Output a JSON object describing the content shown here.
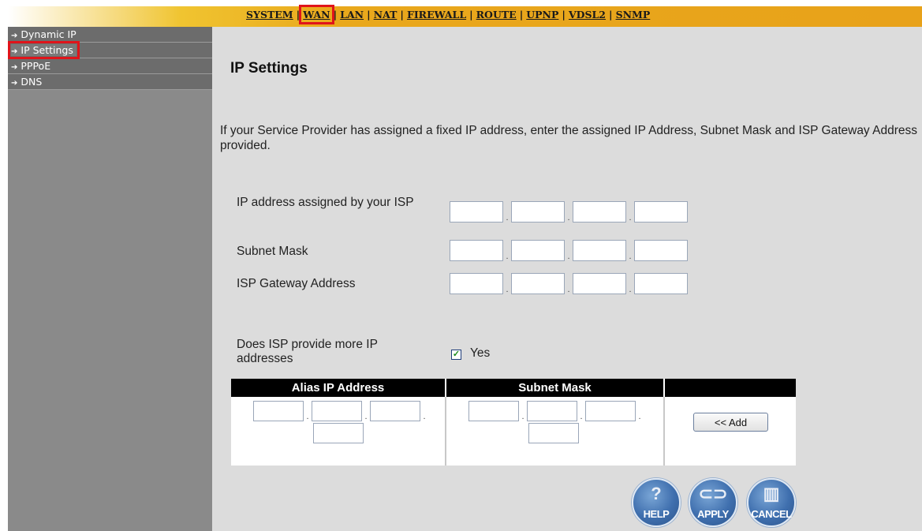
{
  "top_nav": {
    "tabs": [
      {
        "label": "SYSTEM",
        "active": false
      },
      {
        "label": "WAN",
        "active": true
      },
      {
        "label": "LAN",
        "active": false
      },
      {
        "label": "NAT",
        "active": false
      },
      {
        "label": "FIREWALL",
        "active": false
      },
      {
        "label": "ROUTE",
        "active": false
      },
      {
        "label": "UPNP",
        "active": false
      },
      {
        "label": "VDSL2",
        "active": false
      },
      {
        "label": "SNMP",
        "active": false
      }
    ],
    "separator": "|"
  },
  "sidebar": {
    "items": [
      {
        "label": "Dynamic IP",
        "active": false
      },
      {
        "label": "IP Settings",
        "active": true
      },
      {
        "label": "PPPoE",
        "active": false
      },
      {
        "label": "DNS",
        "active": false
      }
    ],
    "arrow": "➔"
  },
  "main": {
    "title": "IP Settings",
    "description": "If your Service Provider has assigned a fixed IP address, enter the assigned IP Address, Subnet Mask and ISP Gateway Address provided.",
    "fields": [
      {
        "label": "IP address assigned by your ISP",
        "octets": [
          "",
          "",
          "",
          ""
        ]
      },
      {
        "label": "Subnet Mask",
        "octets": [
          "",
          "",
          "",
          ""
        ]
      },
      {
        "label": "ISP Gateway Address",
        "octets": [
          "",
          "",
          "",
          ""
        ]
      }
    ],
    "more_ip_question": "Does ISP provide more IP addresses",
    "more_ip_checked": true,
    "more_ip_option": "Yes",
    "alias_table": {
      "headers": [
        "Alias IP Address",
        "Subnet Mask",
        ""
      ],
      "add_button": "<< Add"
    },
    "buttons": {
      "help": "HELP",
      "apply": "APPLY",
      "cancel": "CANCEL"
    }
  },
  "colors": {
    "nav_gradient_end": "#e8a21a",
    "sidebar_bg": "#8a8a8a",
    "sidebar_item_bg": "#6c6c6c",
    "main_bg": "#dcdcdc",
    "highlight_red": "#e0141a",
    "round_button_blue": "#3f6fae"
  }
}
